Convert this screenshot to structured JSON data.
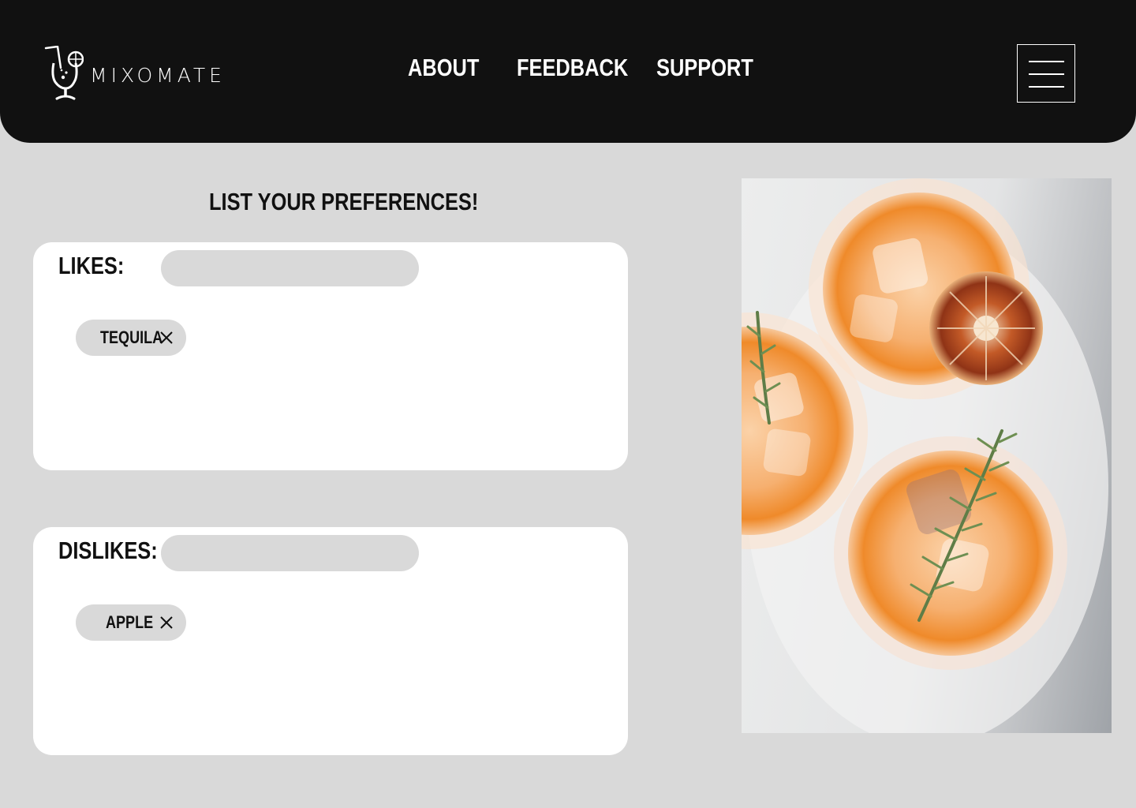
{
  "header": {
    "brand": "MIXOMATE",
    "nav": [
      {
        "label": "ABOUT"
      },
      {
        "label": "FEEDBACK"
      },
      {
        "label": "SUPPORT"
      }
    ],
    "menu_icon": "hamburger-icon",
    "logo_icon": "cocktail-glass-icon"
  },
  "main": {
    "heading": "LIST YOUR PREFERENCES!",
    "likes": {
      "label": "LIKES:",
      "input_value": "",
      "tags": [
        {
          "label": "TEQUILA",
          "remove_icon": "close-icon"
        }
      ]
    },
    "dislikes": {
      "label": "DISLIKES:",
      "input_value": "",
      "tags": [
        {
          "label": "APPLE",
          "remove_icon": "close-icon"
        }
      ]
    }
  },
  "colors": {
    "header_bg": "#111111",
    "page_bg": "#d9d9d9",
    "panel_bg": "#ffffff",
    "chip_bg": "#d9d9d9",
    "text": "#111111",
    "drink_amber": "#f39a3c"
  }
}
